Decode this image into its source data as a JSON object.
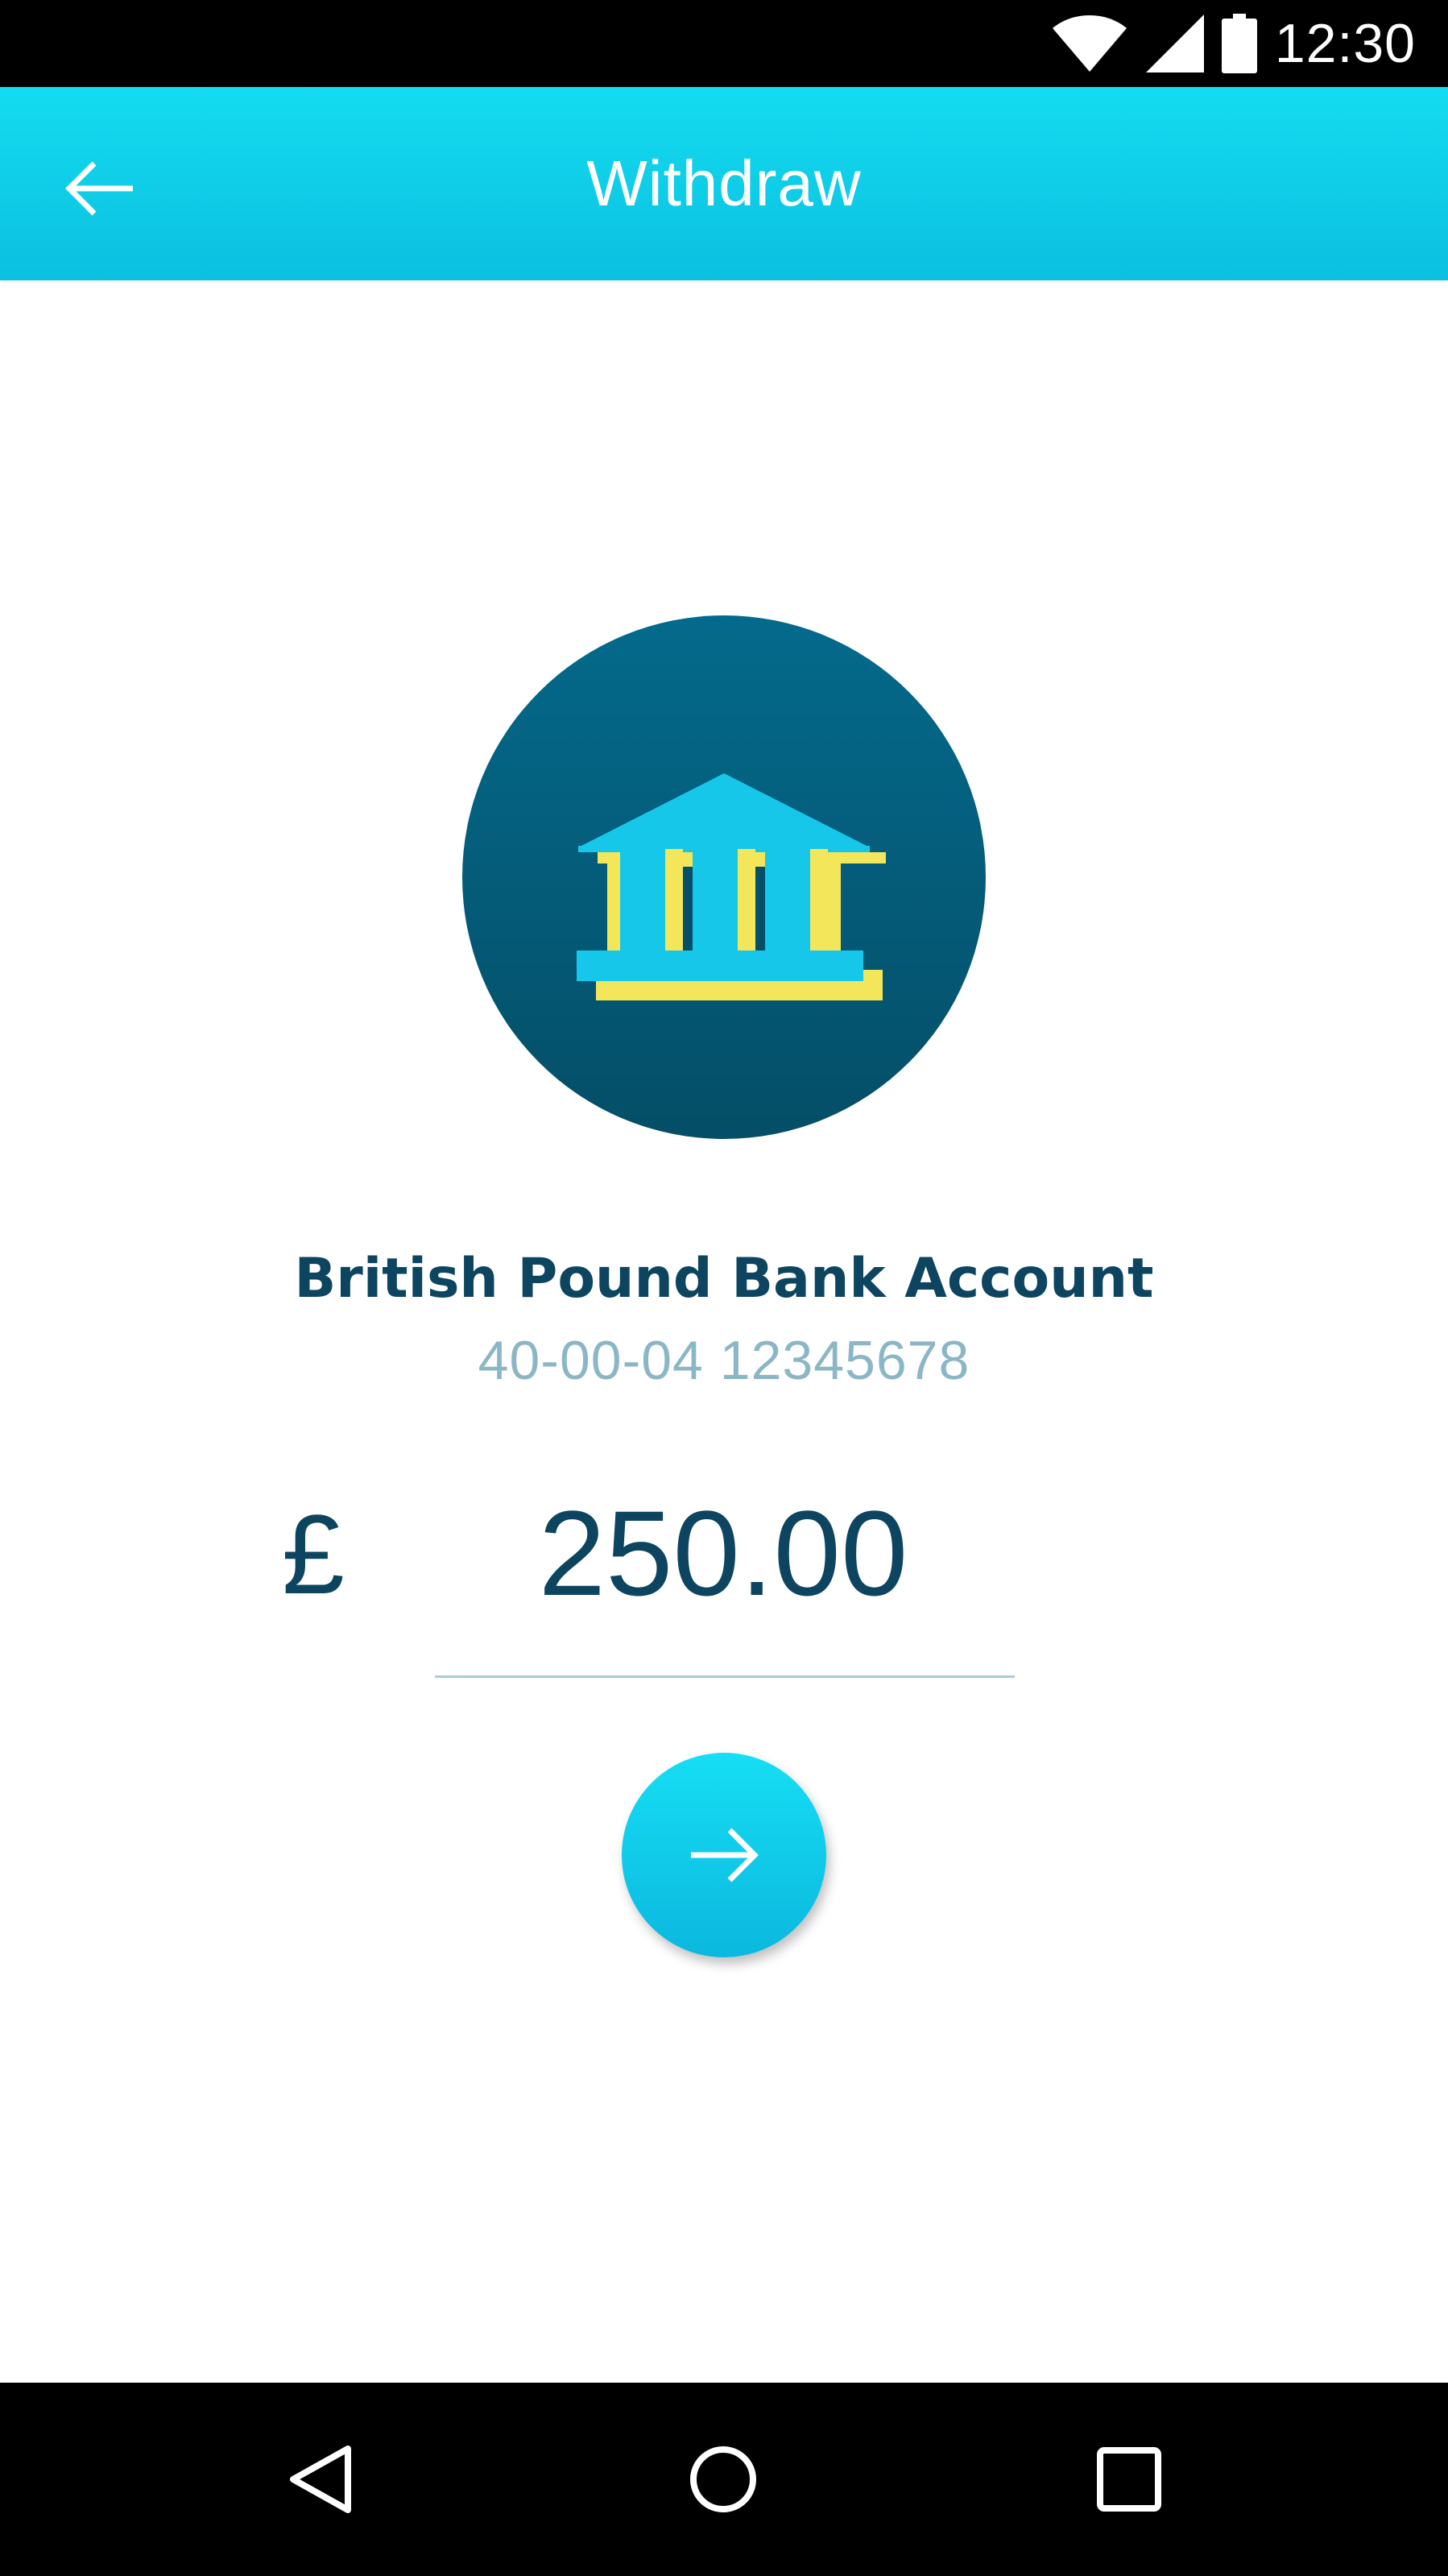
{
  "status_bar": {
    "time": "12:30",
    "icons": [
      "wifi-icon",
      "cell-signal-icon",
      "battery-icon"
    ]
  },
  "app_bar": {
    "title": "Withdraw",
    "back_icon": "arrow-left-icon",
    "background_color": "#12d4ec"
  },
  "account": {
    "icon": "bank-building-icon",
    "name": "British Pound Bank Account",
    "number": "40-00-04 12345678"
  },
  "amount": {
    "currency_symbol": "£",
    "value": "250.00"
  },
  "next_button": {
    "icon": "arrow-right-icon"
  },
  "nav_bar": {
    "icons": [
      "nav-back-icon",
      "nav-home-icon",
      "nav-recents-icon"
    ]
  },
  "colors": {
    "primary": "#12d4ec",
    "dark_text": "#0d4560",
    "muted_text": "#8bb6c6",
    "circle": "#045a78",
    "accent_yellow": "#f5e35a"
  }
}
